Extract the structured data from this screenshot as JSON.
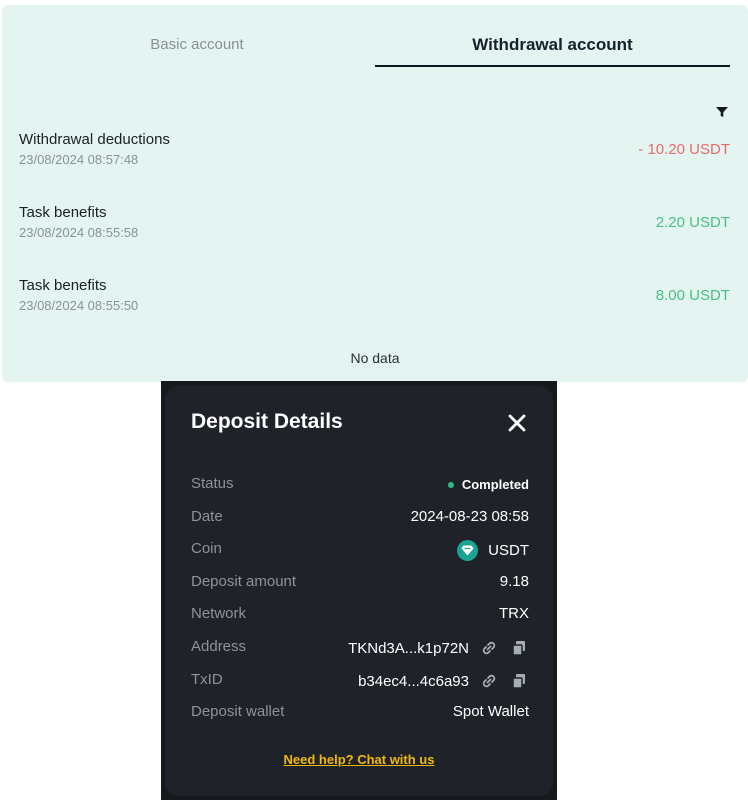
{
  "account_panel": {
    "tabs": [
      {
        "label": "Basic account",
        "active": false
      },
      {
        "label": "Withdrawal account",
        "active": true
      }
    ],
    "transactions": [
      {
        "title": "Withdrawal deductions",
        "time": "23/08/2024 08:57:48",
        "amount": "- 10.20 USDT",
        "direction": "debit"
      },
      {
        "title": "Task benefits",
        "time": "23/08/2024 08:55:58",
        "amount": "2.20 USDT",
        "direction": "credit"
      },
      {
        "title": "Task benefits",
        "time": "23/08/2024 08:55:50",
        "amount": "8.00 USDT",
        "direction": "credit"
      }
    ],
    "no_data_text": "No data",
    "filter_icon": "filter-icon"
  },
  "deposit_modal": {
    "title": "Deposit Details",
    "close_icon": "close-icon",
    "rows": [
      {
        "label": "Status",
        "value": "Completed"
      },
      {
        "label": "Date",
        "value": "2024-08-23 08:58"
      },
      {
        "label": "Coin",
        "value": "USDT"
      },
      {
        "label": "Deposit amount",
        "value": "9.18"
      },
      {
        "label": "Network",
        "value": "TRX"
      },
      {
        "label": "Address",
        "value": "TKNd3A...k1p72N"
      },
      {
        "label": "TxID",
        "value": "b34ec4...4c6a93"
      },
      {
        "label": "Deposit wallet",
        "value": "Spot Wallet"
      }
    ],
    "help_link": "Need help? Chat with us"
  },
  "colors": {
    "panel_bg": "#e4f5f1",
    "debit": "#ea6a6a",
    "credit": "#49c083",
    "modal_bg": "#1f2329",
    "status_green": "#2ebd85",
    "link_yellow": "#f0b90b",
    "coin_teal": "#1aa292"
  }
}
